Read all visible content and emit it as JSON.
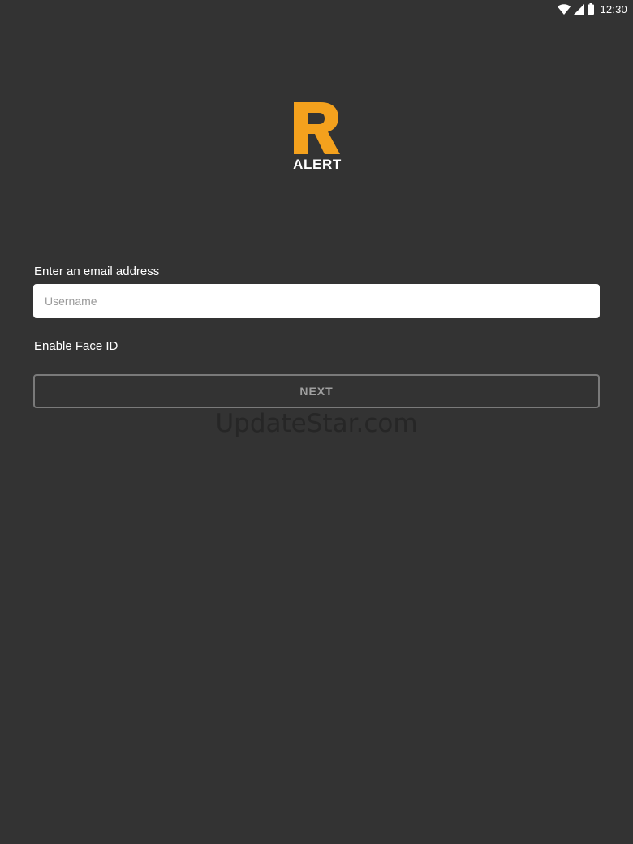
{
  "status_bar": {
    "time": "12:30",
    "icons": [
      "wifi-icon",
      "cell-signal-icon",
      "battery-icon"
    ]
  },
  "logo": {
    "mark_letter": "R",
    "text": "ALERT",
    "accent_color": "#F4A11D"
  },
  "login": {
    "email_label": "Enter an email address",
    "email_value": "",
    "email_placeholder": "Username",
    "face_id_label": "Enable Face ID",
    "next_label": "NEXT"
  },
  "watermark": "UpdateStar.com",
  "colors": {
    "background": "#333333",
    "button_border": "#7A7A7A"
  }
}
